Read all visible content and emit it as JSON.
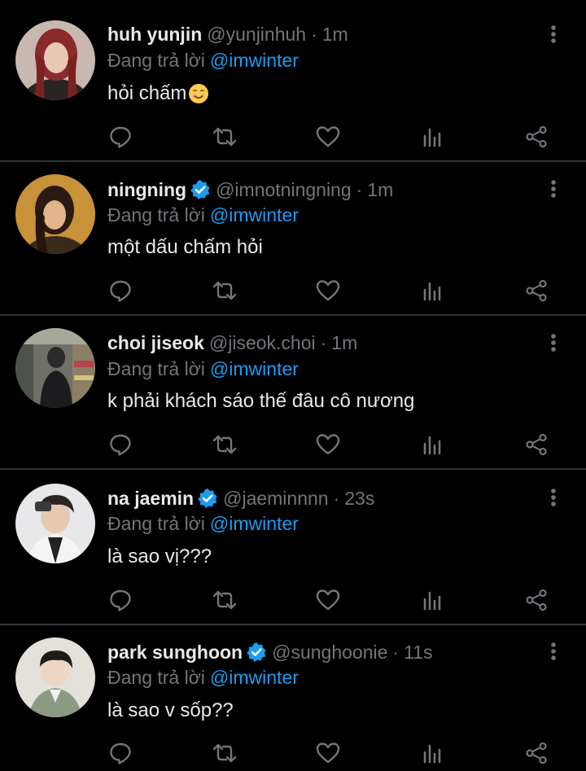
{
  "reply_prefix": "Đang trả lời",
  "colors": {
    "background": "#000000",
    "text": "#e7e9ea",
    "muted": "#71767b",
    "link": "#1d9bf0",
    "divider": "#2f3336"
  },
  "tweets": [
    {
      "name": "huh yunjin",
      "verified": false,
      "handle": "@yunjinhuh",
      "sep": "·",
      "time": "1m",
      "mention": "@imwinter",
      "text": "hỏi chấm",
      "emoji": "smiling-face-icon"
    },
    {
      "name": "ningning",
      "verified": true,
      "handle": "@imnotningning",
      "sep": "·",
      "time": "1m",
      "mention": "@imwinter",
      "text": "một dấu chấm hỏi"
    },
    {
      "name": "choi jiseok",
      "verified": false,
      "handle": "@jiseok.choi",
      "sep": "·",
      "time": "1m",
      "mention": "@imwinter",
      "text": "k phải khách sáo thế đâu cô nương"
    },
    {
      "name": "na jaemin",
      "verified": true,
      "handle": "@jaeminnnn",
      "sep": "·",
      "time": "23s",
      "mention": "@imwinter",
      "text": "là sao vị???"
    },
    {
      "name": "park sunghoon",
      "verified": true,
      "handle": "@sunghoonie",
      "sep": "·",
      "time": "11s",
      "mention": "@imwinter",
      "text": "là sao v sốp??"
    }
  ]
}
